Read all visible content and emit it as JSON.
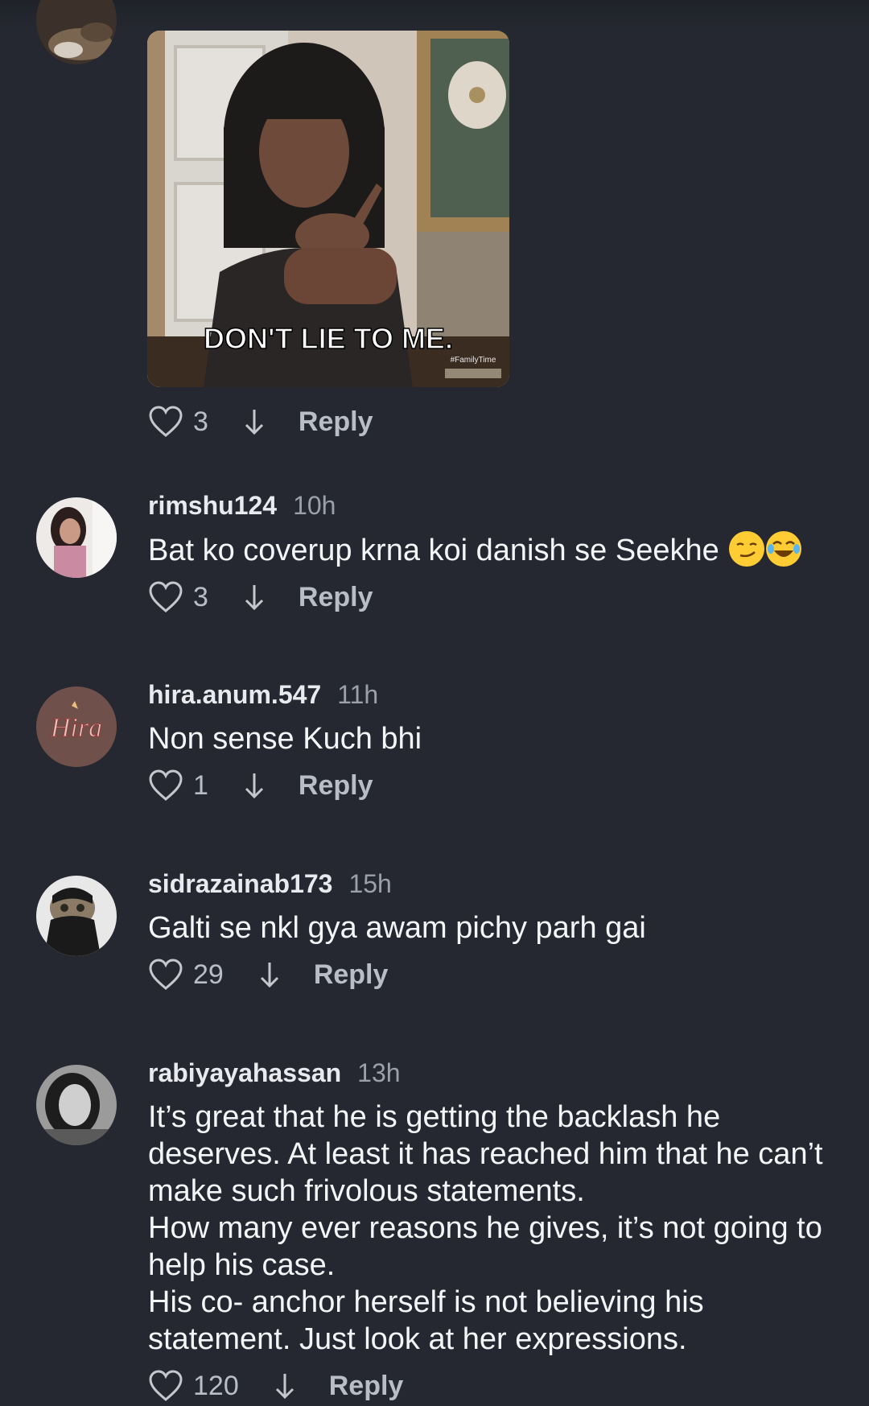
{
  "gif_comment": {
    "gif_caption": "DON'T LIE TO ME.",
    "watermark_tag": "#FamilyTime",
    "likes": "3",
    "reply_label": "Reply"
  },
  "comments": [
    {
      "username": "rimshu124",
      "time": "10h",
      "text": "Bat ko coverup krna koi danish se Seekhe",
      "emojis": [
        "smirking-face-emoji",
        "tears-of-joy-emoji"
      ],
      "likes": "3",
      "reply_label": "Reply"
    },
    {
      "username": "hira.anum.547",
      "time": "11h",
      "text": "Non sense Kuch bhi",
      "avatar_text": "Hira",
      "likes": "1",
      "reply_label": "Reply"
    },
    {
      "username": "sidrazainab173",
      "time": "15h",
      "text": "Galti se nkl gya awam pichy parh gai",
      "likes": "29",
      "reply_label": "Reply"
    },
    {
      "username": "rabiyayahassan",
      "time": "13h",
      "text": "It’s great that he is getting the backlash he deserves. At least it has reached him that he can’t make such frivolous statements.\nHow many ever reasons he gives, it’s not going to help his case.\nHis co- anchor herself is not believing his statement. Just look at her expressions.",
      "likes": "120",
      "reply_label": "Reply"
    }
  ],
  "colors": {
    "background": "#252830",
    "username": "#e9eaee",
    "meta": "#9ba0aa",
    "action": "#b9bdc6"
  }
}
